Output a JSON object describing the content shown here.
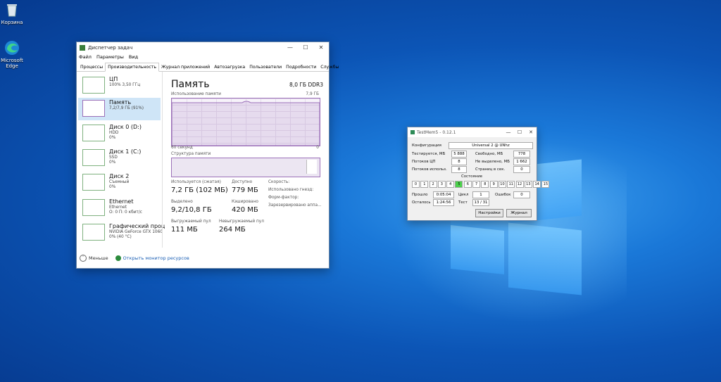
{
  "desktop": {
    "icons": [
      {
        "label": "Корзина",
        "icon": "recycle-bin-icon"
      },
      {
        "label": "Microsoft Edge",
        "icon": "edge-icon"
      }
    ]
  },
  "task_manager": {
    "title": "Диспетчер задач",
    "window_buttons": [
      "—",
      "☐",
      "✕"
    ],
    "menu": [
      "Файл",
      "Параметры",
      "Вид"
    ],
    "tabs": [
      "Процессы",
      "Производительность",
      "Журнал приложений",
      "Автозагрузка",
      "Пользователи",
      "Подробности",
      "Службы"
    ],
    "active_tab": "Производительность",
    "sidebar": [
      {
        "name": "ЦП",
        "line1": "100% 3,50 ГГц",
        "line2": ""
      },
      {
        "name": "Память",
        "line1": "7,2/7,9 ГБ (91%)",
        "line2": ""
      },
      {
        "name": "Диск 0 (D:)",
        "line1": "HDD",
        "line2": "0%"
      },
      {
        "name": "Диск 1 (C:)",
        "line1": "SSD",
        "line2": "0%"
      },
      {
        "name": "Диск 2",
        "line1": "Съемный",
        "line2": "0%"
      },
      {
        "name": "Ethernet",
        "line1": "Ethernet",
        "line2": "О: 0 П: 0 кбит/с"
      },
      {
        "name": "Графический проц",
        "line1": "NVIDIA GeForce GTX 1060",
        "line2": "0% (40 °C)"
      }
    ],
    "selected_index": 1,
    "panel": {
      "title": "Память",
      "spec": "8,0 ГБ DDR3",
      "usage_label": "Использование памяти",
      "usage_max": "7,9 ГБ",
      "time_label": "60 секунд",
      "time_end": "0",
      "structure_label": "Структура памяти",
      "stats": {
        "in_use_label": "Используется (сжатая)",
        "in_use_value": "7,2 ГБ (102 МБ)",
        "available_label": "Доступно",
        "available_value": "779 МБ",
        "committed_label": "Выделено",
        "committed_value": "9,2/10,8 ГБ",
        "cached_label": "Кэшировано",
        "cached_value": "420 МБ",
        "paged_label": "Выгружаемый пул",
        "paged_value": "111 МБ",
        "nonpaged_label": "Невыгружаемый пул",
        "nonpaged_value": "264 МБ",
        "right_col": [
          "Скорость:",
          "Использовано гнезд:",
          "Форм-фактор:",
          "Зарезервировано аппа..."
        ]
      }
    },
    "footer": {
      "less": "Меньше",
      "monitor": "Открыть монитор ресурсов"
    }
  },
  "testmem": {
    "title": "TestMem5 - 0.12.1",
    "window_buttons": [
      "—",
      "☐",
      "✕"
    ],
    "config_label": "Конфигурация",
    "config_value": "Universal 2 @ UNhz",
    "rows": [
      {
        "l1": "Тестируется, МБ",
        "v1": "5 888",
        "l2": "Свободно, МБ",
        "v2": "778"
      },
      {
        "l1": "Потоков ЦП",
        "v1": "8",
        "l2": "Не выделено, МБ",
        "v2": "1 662"
      },
      {
        "l1": "Потоков использ.",
        "v1": "8",
        "l2": "Страниц в сек.",
        "v2": "0"
      }
    ],
    "state_label": "Состояние",
    "cells": [
      "0",
      "1",
      "2",
      "3",
      "4",
      "5",
      "6",
      "7",
      "8",
      "9",
      "10",
      "11",
      "12",
      "13",
      "14",
      "15"
    ],
    "current_cell": 5,
    "elapsed_label": "Прошло",
    "elapsed_value": "0:05:04",
    "cycle_label": "Цикл",
    "cycle_value": "1",
    "errors_label": "Ошибок",
    "errors_value": "0",
    "remaining_label": "Осталось",
    "remaining_value": "1:24:56",
    "test_label": "Тест",
    "test_value": "13 / 31",
    "settings_button": "Настройки",
    "log_button": "Журнал"
  }
}
